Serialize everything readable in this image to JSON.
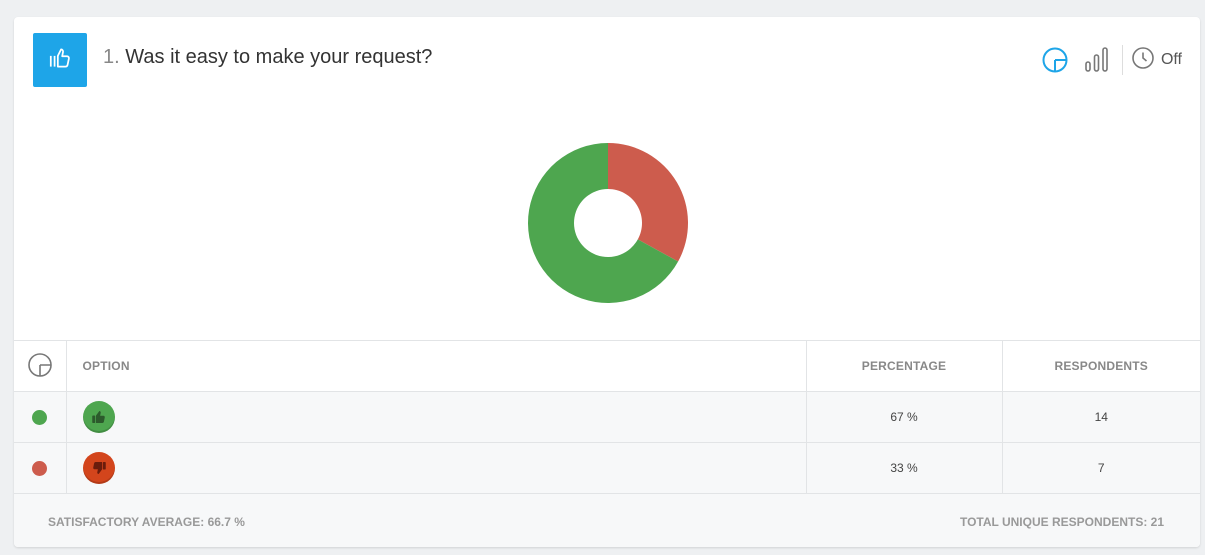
{
  "question": {
    "number": "1.",
    "text": "Was it easy to make your request?",
    "icon": "thumbs-up-icon"
  },
  "toolbar": {
    "pie_icon": "pie-chart-icon",
    "bar_icon": "bar-chart-icon",
    "timer_icon": "clock-icon",
    "timer_label": "Off"
  },
  "chart_data": {
    "type": "pie",
    "categories": [
      "thumbs-up",
      "thumbs-down"
    ],
    "values": [
      67,
      33
    ],
    "colors": [
      "#4ea64f",
      "#cd5c4d"
    ]
  },
  "table": {
    "header_icon": "pie-chart-icon",
    "columns": [
      "OPTION",
      "PERCENTAGE",
      "RESPONDENTS"
    ],
    "rows": [
      {
        "color": "#4ea64f",
        "icon": "thumbs-up-icon",
        "percentage": "67 %",
        "respondents": "14"
      },
      {
        "color": "#cd5c4d",
        "icon": "thumbs-down-icon",
        "percentage": "33 %",
        "respondents": "7"
      }
    ]
  },
  "footer": {
    "average": "SATISFACTORY AVERAGE: 66.7 %",
    "total": "TOTAL UNIQUE RESPONDENTS: 21"
  }
}
